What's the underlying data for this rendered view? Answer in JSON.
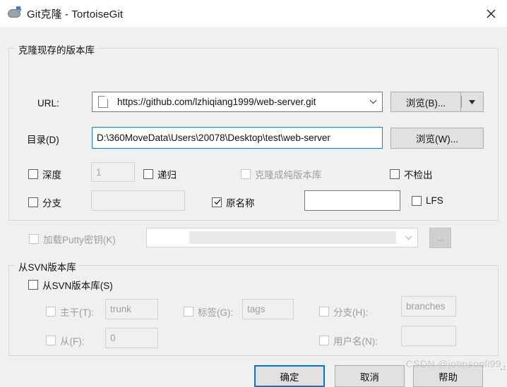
{
  "window": {
    "title": "Git克隆 - TortoiseGit",
    "icon": "tortoisegit-turtle-icon",
    "close_label": "✕"
  },
  "clone_group": {
    "title": "克隆现存的版本库",
    "url": {
      "label": "URL:",
      "value": "https://github.com/lzhiqiang1999/web-server.git",
      "browse_label": "浏览(B)..."
    },
    "directory": {
      "label": "目录(D)",
      "value": "D:\\360MoveData\\Users\\20078\\Desktop\\test\\web-server",
      "browse_label": "浏览(W)..."
    },
    "depth": {
      "label": "深度",
      "checked": false,
      "value": "1",
      "enabled": false
    },
    "recursive": {
      "label": "递归",
      "checked": false
    },
    "bare": {
      "label": "克隆成纯版本库",
      "checked": false,
      "enabled": false
    },
    "no_checkout": {
      "label": "不检出",
      "checked": false
    },
    "branch": {
      "label": "分支",
      "checked": false,
      "value": "",
      "enabled": false
    },
    "origin_name": {
      "label": "原名称",
      "checked": true,
      "value": ""
    },
    "lfs": {
      "label": "LFS",
      "checked": false
    },
    "putty_key": {
      "label": "加载Putty密钥(K)",
      "checked": false,
      "enabled": false,
      "value": "",
      "browse_label": "..."
    }
  },
  "svn_group": {
    "title": "从SVN版本库",
    "from_svn": {
      "label": "从SVN版本库(S)",
      "checked": false
    },
    "trunk": {
      "label": "主干(T):",
      "checked": false,
      "value": "trunk"
    },
    "tags": {
      "label": "标签(G):",
      "checked": false,
      "value": "tags"
    },
    "branches": {
      "label": "分支(H):",
      "checked": false,
      "value": "branches"
    },
    "from_rev": {
      "label": "从(F):",
      "checked": false,
      "value": "0"
    },
    "username": {
      "label": "用户名(N):",
      "checked": false,
      "value": ""
    }
  },
  "footer": {
    "ok_label": "确定",
    "cancel_label": "取消",
    "help_label": "帮助"
  },
  "watermark": {
    "text": "CSDN @johnsonli99"
  },
  "colors": {
    "accent": "#0078d7",
    "focus_border": "#2c7ad6",
    "dialog_bg": "#f0f0f0",
    "titlebar_bg": "#ffffff"
  }
}
